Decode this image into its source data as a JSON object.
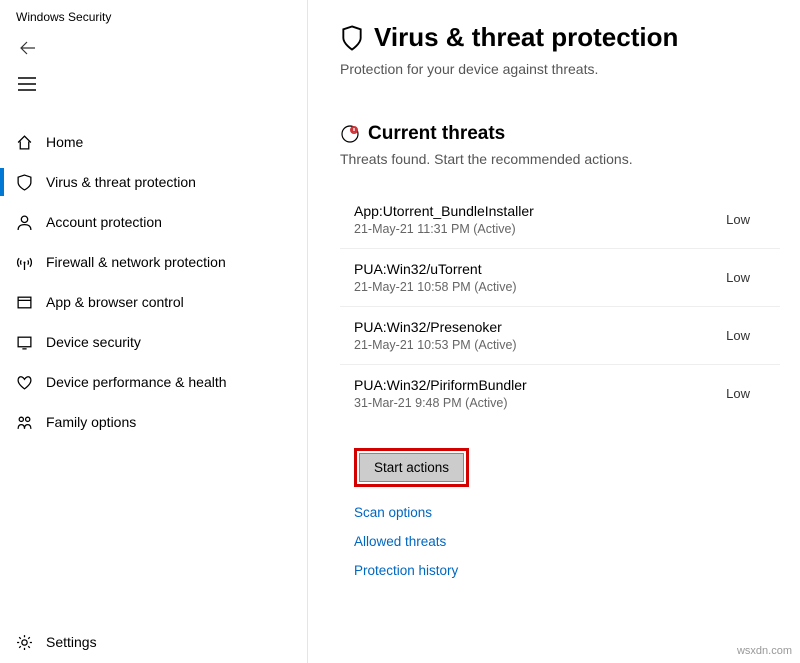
{
  "app_title": "Windows Security",
  "sidebar": {
    "items": [
      {
        "label": "Home"
      },
      {
        "label": "Virus & threat protection"
      },
      {
        "label": "Account protection"
      },
      {
        "label": "Firewall & network protection"
      },
      {
        "label": "App & browser control"
      },
      {
        "label": "Device security"
      },
      {
        "label": "Device performance & health"
      },
      {
        "label": "Family options"
      }
    ],
    "settings_label": "Settings"
  },
  "main": {
    "title": "Virus & threat protection",
    "subtitle": "Protection for your device against threats.",
    "current_threats": {
      "heading": "Current threats",
      "subheading": "Threats found. Start the recommended actions.",
      "items": [
        {
          "name": "App:Utorrent_BundleInstaller",
          "meta": "21-May-21 11:31 PM (Active)",
          "severity": "Low"
        },
        {
          "name": "PUA:Win32/uTorrent",
          "meta": "21-May-21 10:58 PM (Active)",
          "severity": "Low"
        },
        {
          "name": "PUA:Win32/Presenoker",
          "meta": "21-May-21 10:53 PM (Active)",
          "severity": "Low"
        },
        {
          "name": "PUA:Win32/PiriformBundler",
          "meta": "31-Mar-21 9:48 PM (Active)",
          "severity": "Low"
        }
      ]
    },
    "start_actions_label": "Start actions",
    "links": {
      "scan_options": "Scan options",
      "allowed_threats": "Allowed threats",
      "protection_history": "Protection history"
    }
  },
  "watermark": "wsxdn.com"
}
